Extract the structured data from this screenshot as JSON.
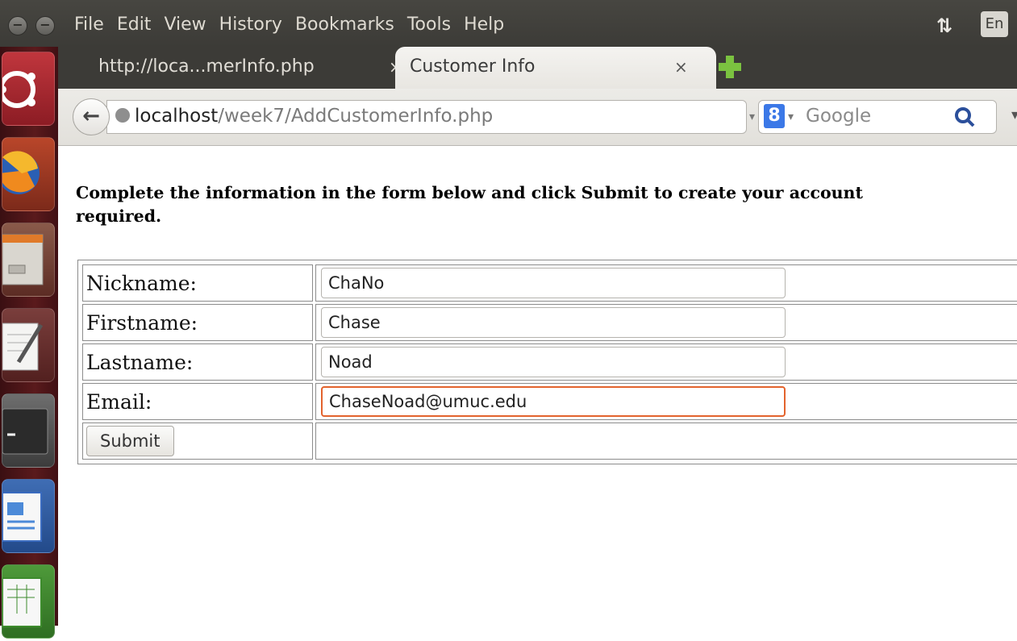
{
  "menubar": {
    "items": [
      "File",
      "Edit",
      "View",
      "History",
      "Bookmarks",
      "Tools",
      "Help"
    ],
    "language": "En"
  },
  "tabs": [
    {
      "title": "http://loca...merInfo.php",
      "active": false,
      "close": "×"
    },
    {
      "title": "Customer Info",
      "active": true,
      "close": "×"
    }
  ],
  "navigation": {
    "url_host": "localhost",
    "url_path": "/week7/AddCustomerInfo.php",
    "search_engine_placeholder": "Google"
  },
  "page": {
    "instructions": "Complete the information in the form below and click Submit to create your account",
    "instructions_line2": "required.",
    "fields": [
      {
        "label": "Nickname:",
        "value": "ChaNo"
      },
      {
        "label": "Firstname:",
        "value": "Chase"
      },
      {
        "label": "Lastname:",
        "value": "Noad"
      },
      {
        "label": "Email:",
        "value": "ChaseNoad@umuc.edu"
      }
    ],
    "submit_label": "Submit"
  },
  "colors": {
    "focus_border": "#e3632d",
    "launcher": "#5a1a1c",
    "menubar": "#3c3b37"
  },
  "icons": {
    "window_close": "minus-circle-icon",
    "window_minimize": "minus-icon",
    "network": "network-arrows-icon",
    "back": "back-arrow-icon",
    "reload": "reload-icon",
    "search": "magnifier-icon",
    "new_tab": "plus-icon"
  }
}
